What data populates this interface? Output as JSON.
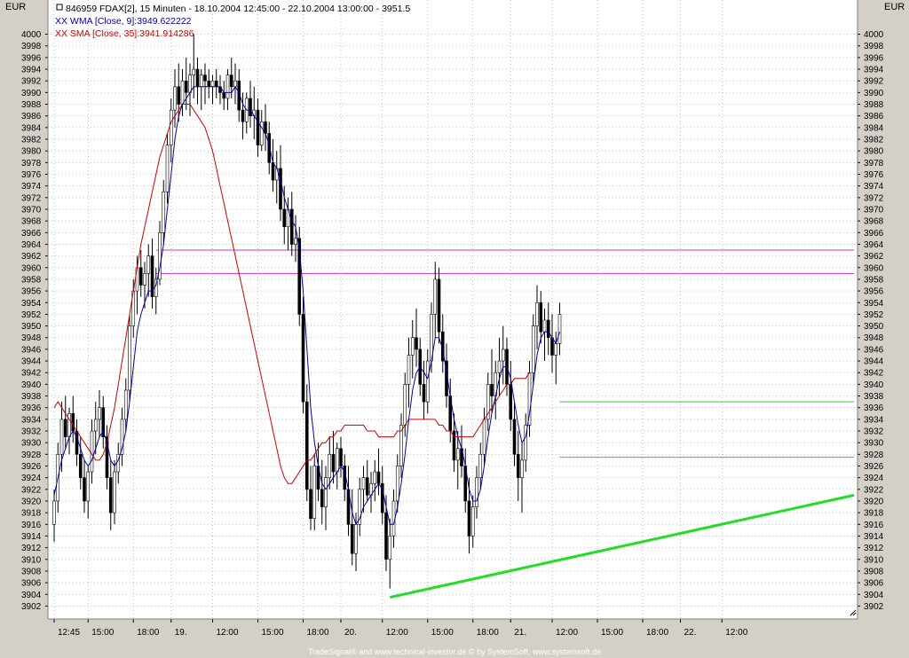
{
  "currency_left": "EUR",
  "currency_right": "EUR",
  "footer": "TradeSignal® and www.technical-investor.de © by SystemSoft, www.systemsoft.de",
  "chart_data": {
    "type": "candlestick",
    "title": "846959  FDAX[2], 15 Minuten - 18.10.2004 12:45:00 - 22.10.2004 13:00:00 - 3951.5",
    "legend": [
      {
        "label": "XX WMA [Close, 9]:3949.622222",
        "color": "#0000aa"
      },
      {
        "label": "XX SMA [Close, 35]:3941.914286",
        "color": "#cc0000"
      }
    ],
    "ylim": [
      3901,
      4001
    ],
    "y_ticks": [
      3902,
      3904,
      3906,
      3908,
      3910,
      3912,
      3914,
      3916,
      3918,
      3920,
      3922,
      3924,
      3926,
      3928,
      3930,
      3932,
      3934,
      3936,
      3938,
      3940,
      3942,
      3944,
      3946,
      3948,
      3950,
      3952,
      3954,
      3956,
      3958,
      3960,
      3962,
      3964,
      3966,
      3968,
      3970,
      3972,
      3974,
      3976,
      3978,
      3980,
      3982,
      3984,
      3986,
      3988,
      3990,
      3992,
      3994,
      3996,
      3998,
      4000
    ],
    "x_tick_labels": [
      {
        "label": "12:45",
        "bar": 0
      },
      {
        "label": "15:00",
        "bar": 9
      },
      {
        "label": "18:00",
        "bar": 21
      },
      {
        "label": "19.",
        "bar": 31
      },
      {
        "label": "12:00",
        "bar": 42
      },
      {
        "label": "15:00",
        "bar": 54
      },
      {
        "label": "18:00",
        "bar": 66
      },
      {
        "label": "20.",
        "bar": 76
      },
      {
        "label": "12:00",
        "bar": 87
      },
      {
        "label": "15:00",
        "bar": 99
      },
      {
        "label": "18:00",
        "bar": 111
      },
      {
        "label": "21.",
        "bar": 121
      },
      {
        "label": "12:00",
        "bar": 132
      },
      {
        "label": "15:00",
        "bar": 144
      },
      {
        "label": "18:00",
        "bar": 156
      },
      {
        "label": "22.",
        "bar": 166
      },
      {
        "label": "12:00",
        "bar": 177
      }
    ],
    "candles_ohlc": [
      [
        3916,
        3922,
        3913,
        3920
      ],
      [
        3920,
        3930,
        3918,
        3928
      ],
      [
        3928,
        3937,
        3925,
        3934
      ],
      [
        3934,
        3938,
        3929,
        3931
      ],
      [
        3931,
        3936,
        3928,
        3935
      ],
      [
        3935,
        3938,
        3930,
        3932
      ],
      [
        3932,
        3934,
        3926,
        3928
      ],
      [
        3928,
        3931,
        3922,
        3924
      ],
      [
        3924,
        3927,
        3918,
        3920
      ],
      [
        3920,
        3926,
        3917,
        3925
      ],
      [
        3925,
        3934,
        3923,
        3932
      ],
      [
        3932,
        3937,
        3928,
        3934
      ],
      [
        3934,
        3939,
        3931,
        3936
      ],
      [
        3936,
        3938,
        3929,
        3931
      ],
      [
        3931,
        3933,
        3922,
        3924
      ],
      [
        3924,
        3927,
        3915,
        3918
      ],
      [
        3918,
        3927,
        3916,
        3925
      ],
      [
        3925,
        3930,
        3923,
        3928
      ],
      [
        3928,
        3936,
        3926,
        3934
      ],
      [
        3934,
        3941,
        3932,
        3939
      ],
      [
        3939,
        3952,
        3937,
        3950
      ],
      [
        3950,
        3958,
        3948,
        3956
      ],
      [
        3956,
        3962,
        3952,
        3960
      ],
      [
        3960,
        3963,
        3955,
        3957
      ],
      [
        3957,
        3961,
        3953,
        3959
      ],
      [
        3959,
        3964,
        3955,
        3962
      ],
      [
        3962,
        3965,
        3953,
        3955
      ],
      [
        3955,
        3960,
        3952,
        3958
      ],
      [
        3958,
        3968,
        3957,
        3966
      ],
      [
        3966,
        3975,
        3964,
        3973
      ],
      [
        3973,
        3983,
        3971,
        3981
      ],
      [
        3981,
        3989,
        3978,
        3987
      ],
      [
        3987,
        3994,
        3984,
        3991
      ],
      [
        3991,
        3995,
        3985,
        3988
      ],
      [
        3988,
        3994,
        3986,
        3992
      ],
      [
        3992,
        3996,
        3987,
        3990
      ],
      [
        3990,
        3995,
        3986,
        3993
      ],
      [
        3993,
        4000,
        3989,
        3994
      ],
      [
        3994,
        3996,
        3988,
        3991
      ],
      [
        3991,
        3994,
        3987,
        3993
      ],
      [
        3993,
        3995,
        3988,
        3992
      ],
      [
        3992,
        3994,
        3989,
        3991
      ],
      [
        3991,
        3993,
        3988,
        3992
      ],
      [
        3992,
        3994,
        3989,
        3991
      ],
      [
        3991,
        3993,
        3988,
        3990
      ],
      [
        3990,
        3992,
        3987,
        3989
      ],
      [
        3989,
        3994,
        3987,
        3993
      ],
      [
        3993,
        3996,
        3989,
        3991
      ],
      [
        3991,
        3995,
        3988,
        3992
      ],
      [
        3992,
        3994,
        3985,
        3987
      ],
      [
        3987,
        3990,
        3982,
        3985
      ],
      [
        3985,
        3990,
        3983,
        3989
      ],
      [
        3989,
        3992,
        3984,
        3986
      ],
      [
        3986,
        3991,
        3982,
        3987
      ],
      [
        3987,
        3989,
        3979,
        3981
      ],
      [
        3981,
        3987,
        3980,
        3985
      ],
      [
        3985,
        3988,
        3980,
        3983
      ],
      [
        3983,
        3985,
        3976,
        3978
      ],
      [
        3978,
        3982,
        3973,
        3975
      ],
      [
        3975,
        3980,
        3971,
        3977
      ],
      [
        3977,
        3981,
        3968,
        3970
      ],
      [
        3970,
        3974,
        3964,
        3967
      ],
      [
        3967,
        3972,
        3963,
        3970
      ],
      [
        3970,
        3973,
        3962,
        3964
      ],
      [
        3964,
        3969,
        3961,
        3965
      ],
      [
        3965,
        3967,
        3950,
        3952
      ],
      [
        3952,
        3955,
        3935,
        3937
      ],
      [
        3937,
        3940,
        3920,
        3922
      ],
      [
        3922,
        3926,
        3915,
        3917
      ],
      [
        3917,
        3928,
        3915,
        3926
      ],
      [
        3926,
        3930,
        3920,
        3922
      ],
      [
        3922,
        3927,
        3916,
        3919
      ],
      [
        3919,
        3926,
        3915,
        3924
      ],
      [
        3924,
        3931,
        3922,
        3928
      ],
      [
        3928,
        3932,
        3923,
        3925
      ],
      [
        3925,
        3930,
        3922,
        3929
      ],
      [
        3929,
        3931,
        3924,
        3926
      ],
      [
        3926,
        3928,
        3920,
        3922
      ],
      [
        3922,
        3926,
        3914,
        3916
      ],
      [
        3916,
        3922,
        3909,
        3911
      ],
      [
        3911,
        3918,
        3908,
        3916
      ],
      [
        3916,
        3924,
        3914,
        3922
      ],
      [
        3922,
        3926,
        3918,
        3924
      ],
      [
        3924,
        3927,
        3920,
        3921
      ],
      [
        3921,
        3925,
        3918,
        3923
      ],
      [
        3923,
        3927,
        3920,
        3925
      ],
      [
        3925,
        3929,
        3921,
        3923
      ],
      [
        3923,
        3926,
        3916,
        3918
      ],
      [
        3918,
        3921,
        3908,
        3910
      ],
      [
        3910,
        3917,
        3905,
        3914
      ],
      [
        3914,
        3922,
        3912,
        3920
      ],
      [
        3920,
        3928,
        3918,
        3926
      ],
      [
        3926,
        3935,
        3924,
        3933
      ],
      [
        3933,
        3942,
        3931,
        3940
      ],
      [
        3940,
        3948,
        3936,
        3945
      ],
      [
        3945,
        3951,
        3941,
        3948
      ],
      [
        3948,
        3953,
        3943,
        3946
      ],
      [
        3946,
        3948,
        3938,
        3940
      ],
      [
        3940,
        3944,
        3934,
        3937
      ],
      [
        3937,
        3946,
        3935,
        3944
      ],
      [
        3944,
        3954,
        3942,
        3952
      ],
      [
        3952,
        3961,
        3948,
        3958
      ],
      [
        3958,
        3960,
        3947,
        3949
      ],
      [
        3949,
        3952,
        3942,
        3944
      ],
      [
        3944,
        3947,
        3936,
        3938
      ],
      [
        3938,
        3941,
        3930,
        3932
      ],
      [
        3932,
        3935,
        3925,
        3927
      ],
      [
        3927,
        3932,
        3922,
        3929
      ],
      [
        3929,
        3933,
        3924,
        3926
      ],
      [
        3926,
        3929,
        3918,
        3920
      ],
      [
        3920,
        3924,
        3911,
        3914
      ],
      [
        3914,
        3921,
        3912,
        3919
      ],
      [
        3919,
        3926,
        3917,
        3924
      ],
      [
        3924,
        3930,
        3922,
        3928
      ],
      [
        3928,
        3936,
        3926,
        3934
      ],
      [
        3934,
        3942,
        3932,
        3940
      ],
      [
        3940,
        3946,
        3935,
        3938
      ],
      [
        3938,
        3944,
        3934,
        3942
      ],
      [
        3942,
        3948,
        3938,
        3944
      ],
      [
        3944,
        3950,
        3940,
        3946
      ],
      [
        3946,
        3948,
        3938,
        3940
      ],
      [
        3940,
        3944,
        3932,
        3934
      ],
      [
        3934,
        3937,
        3926,
        3928
      ],
      [
        3928,
        3932,
        3920,
        3924
      ],
      [
        3924,
        3930,
        3918,
        3927
      ],
      [
        3927,
        3935,
        3925,
        3933
      ],
      [
        3933,
        3944,
        3931,
        3942
      ],
      [
        3942,
        3952,
        3940,
        3950
      ],
      [
        3950,
        3957,
        3946,
        3954
      ],
      [
        3954,
        3956,
        3947,
        3949
      ],
      [
        3949,
        3953,
        3944,
        3951
      ],
      [
        3951,
        3954,
        3945,
        3948
      ],
      [
        3948,
        3952,
        3942,
        3945
      ],
      [
        3945,
        3949,
        3940,
        3947
      ],
      [
        3947,
        3954,
        3945,
        3952
      ]
    ],
    "wma_9": [
      3921,
      3924,
      3927,
      3929,
      3931,
      3932,
      3931,
      3929,
      3927,
      3926,
      3927,
      3929,
      3931,
      3932,
      3930,
      3927,
      3926,
      3927,
      3929,
      3932,
      3937,
      3943,
      3949,
      3952,
      3954,
      3956,
      3956,
      3957,
      3960,
      3964,
      3970,
      3976,
      3982,
      3986,
      3988,
      3989,
      3990,
      3991,
      3991,
      3991,
      3991,
      3991,
      3991,
      3991,
      3991,
      3990,
      3990,
      3990,
      3991,
      3990,
      3988,
      3987,
      3987,
      3986,
      3985,
      3984,
      3983,
      3981,
      3978,
      3977,
      3975,
      3972,
      3970,
      3968,
      3967,
      3963,
      3956,
      3946,
      3936,
      3930,
      3926,
      3923,
      3922,
      3923,
      3924,
      3925,
      3926,
      3925,
      3922,
      3918,
      3916,
      3917,
      3919,
      3920,
      3921,
      3922,
      3923,
      3922,
      3919,
      3916,
      3916,
      3919,
      3923,
      3928,
      3934,
      3939,
      3942,
      3943,
      3942,
      3941,
      3944,
      3948,
      3948,
      3946,
      3942,
      3938,
      3934,
      3931,
      3929,
      3926,
      3922,
      3920,
      3920,
      3922,
      3926,
      3931,
      3935,
      3938,
      3941,
      3943,
      3943,
      3941,
      3937,
      3933,
      3930,
      3931,
      3935,
      3940,
      3945,
      3948,
      3949,
      3949,
      3948,
      3947,
      3949
    ],
    "sma_35": [
      3936,
      3937,
      3936,
      3935,
      3934,
      3933,
      3932,
      3931,
      3930,
      3929,
      3928,
      3927,
      3927,
      3928,
      3930,
      3933,
      3936,
      3940,
      3944,
      3948,
      3952,
      3956,
      3960,
      3964,
      3967,
      3970,
      3973,
      3976,
      3979,
      3981,
      3983,
      3985,
      3986,
      3987,
      3988,
      3988,
      3988,
      3987,
      3986,
      3985,
      3984,
      3982,
      3980,
      3977,
      3974,
      3971,
      3968,
      3965,
      3962,
      3959,
      3956,
      3953,
      3950,
      3947,
      3944,
      3941,
      3938,
      3935,
      3932,
      3929,
      3926,
      3924,
      3923,
      3923,
      3924,
      3925,
      3926,
      3927,
      3927,
      3928,
      3929,
      3930,
      3930,
      3931,
      3931,
      3932,
      3932,
      3933,
      3933,
      3933,
      3933,
      3933,
      3933,
      3932,
      3932,
      3932,
      3931,
      3931,
      3931,
      3931,
      3931,
      3932,
      3932,
      3933,
      3934,
      3934,
      3934,
      3934,
      3934,
      3934,
      3934,
      3934,
      3933,
      3933,
      3932,
      3932,
      3931,
      3931,
      3931,
      3931,
      3931,
      3931,
      3932,
      3933,
      3934,
      3935,
      3936,
      3937,
      3938,
      3939,
      3940,
      3940,
      3941,
      3941,
      3941,
      3941,
      3942
    ],
    "horizontal_lines": [
      {
        "y": 3963,
        "color": "#cc33cc",
        "from_bar": 27
      },
      {
        "y": 3959,
        "color": "#cc33cc",
        "from_bar": 27
      },
      {
        "y": 3937,
        "color": "#33cc33",
        "from_bar": 134
      },
      {
        "y": 3927.5,
        "color": "#33cc33",
        "from_bar": 134
      }
    ],
    "trendline": {
      "from": [
        89,
        3903.5
      ],
      "to": [
        160,
        3921
      ],
      "color": "#22dd22"
    }
  }
}
